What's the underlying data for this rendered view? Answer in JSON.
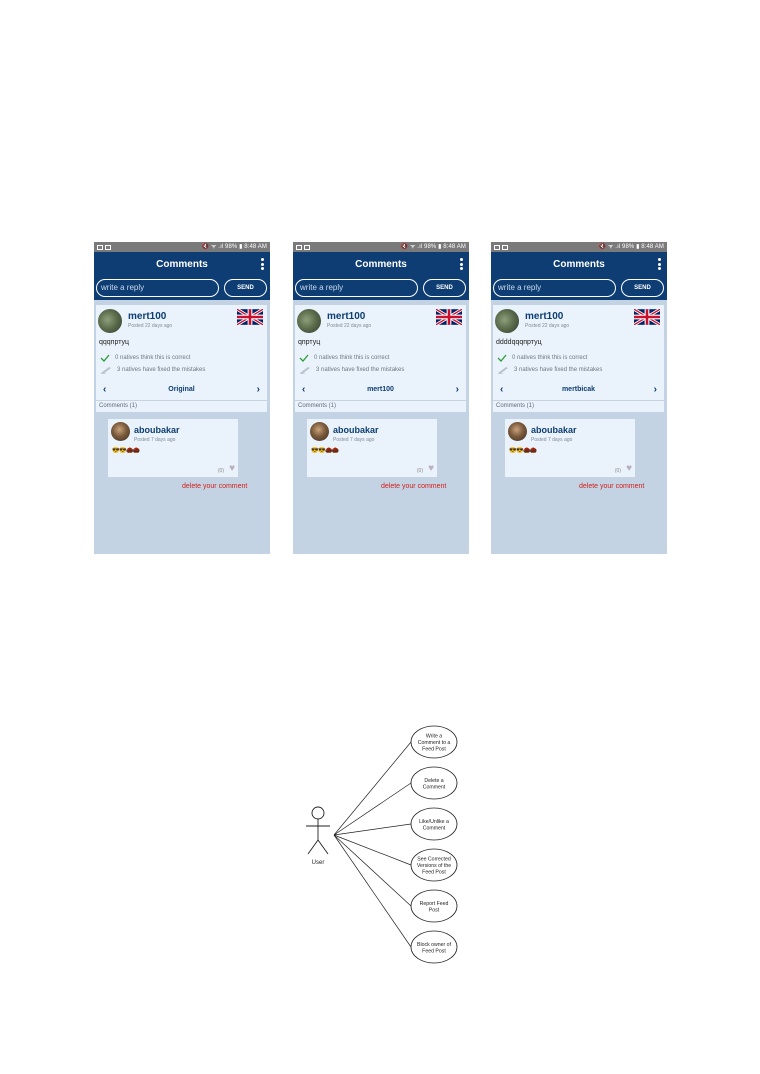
{
  "phones": [
    {
      "status_bar": {
        "right": "🔇 ᯤ .ıl 98% ▮ 8:48 AM"
      },
      "title": "Comments",
      "reply_placeholder": "write a reply",
      "send_label": "SEND",
      "post": {
        "username": "mert100",
        "posted": "Posted 22 days ago",
        "text": "qqqпртуц",
        "correct_text": "0 natives think this is correct",
        "fixed_text": "3 natives have fixed the mistakes",
        "version_label": "Original",
        "prev_glyph": "‹",
        "next_glyph": "›"
      },
      "comments_header": "Comments (1)",
      "comment": {
        "username": "aboubakar",
        "posted": "Posted 7 days ago",
        "emojis": "😎😎🌰🌰",
        "like_count": "(0)",
        "heart_glyph": "♥"
      },
      "delete_label": "delete your comment"
    },
    {
      "status_bar": {
        "right": "🔇 ᯤ .ıl 98% ▮ 8:48 AM"
      },
      "title": "Comments",
      "reply_placeholder": "write a reply",
      "send_label": "SEND",
      "post": {
        "username": "mert100",
        "posted": "Posted 22 days ago",
        "text": "qпртуц",
        "correct_text": "0 natives think this is correct",
        "fixed_text": "3 natives have fixed the mistakes",
        "version_label": "mert100",
        "prev_glyph": "‹",
        "next_glyph": "›"
      },
      "comments_header": "Comments (1)",
      "comment": {
        "username": "aboubakar",
        "posted": "Posted 7 days ago",
        "emojis": "😎😎🌰🌰",
        "like_count": "(0)",
        "heart_glyph": "♥"
      },
      "delete_label": "delete your comment"
    },
    {
      "status_bar": {
        "right": "🔇 ᯤ .ıl 98% ▮ 8:48 AM"
      },
      "title": "Comments",
      "reply_placeholder": "write a reply",
      "send_label": "SEND",
      "post": {
        "username": "mert100",
        "posted": "Posted 22 days ago",
        "text": "ddddqqqпртуц",
        "correct_text": "0 natives think this is correct",
        "fixed_text": "3 natives have fixed the mistakes",
        "version_label": "mertbicak",
        "prev_glyph": "‹",
        "next_glyph": "›"
      },
      "comments_header": "Comments (1)",
      "comment": {
        "username": "aboubakar",
        "posted": "Posted 7 days ago",
        "emojis": "😎😎🌰🌰",
        "like_count": "(0)",
        "heart_glyph": "♥"
      },
      "delete_label": "delete your comment"
    }
  ],
  "use_case_diagram": {
    "actor": "User",
    "use_cases": [
      [
        "Write a",
        "Comment to a",
        "Feed Post"
      ],
      [
        "Delete a",
        "Comment"
      ],
      [
        "Like/Unlike a",
        "Comment"
      ],
      [
        "See Corrected",
        "Versions of the",
        "Feed Post"
      ],
      [
        "Report Feed",
        "Post"
      ],
      [
        "Block owner of",
        "Feed Post"
      ]
    ]
  },
  "colors": {
    "app_bar": "#0d3d73",
    "background": "#c3d3e3",
    "card": "#eaf3fb",
    "delete": "#d2201b",
    "check": "#2e9b3a"
  }
}
